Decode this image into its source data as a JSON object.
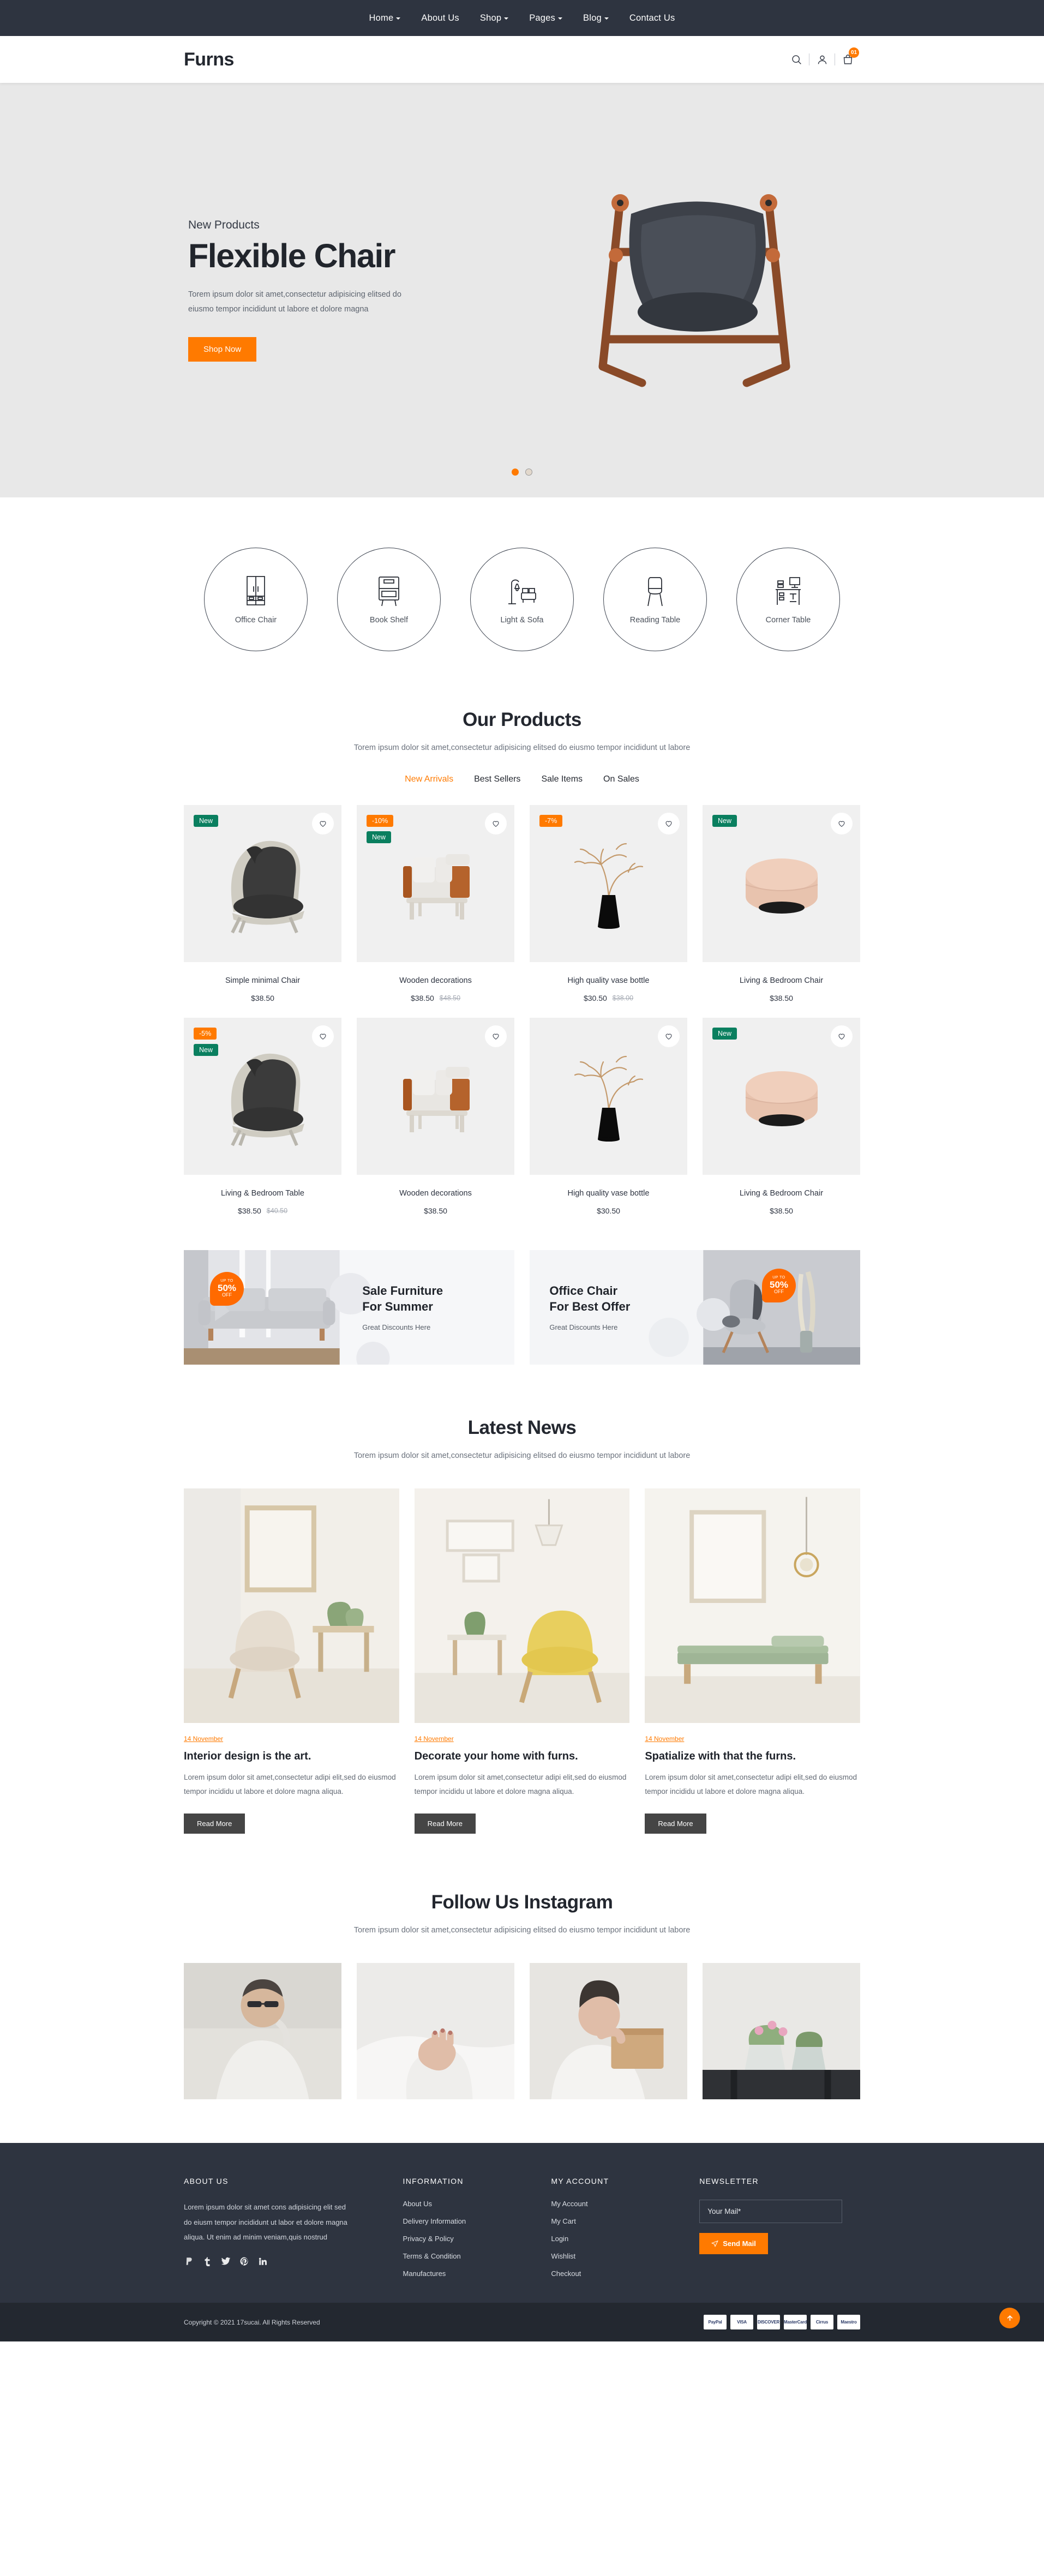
{
  "topnav": {
    "items": [
      {
        "label": "Home",
        "has_caret": true
      },
      {
        "label": "About Us",
        "has_caret": false
      },
      {
        "label": "Shop",
        "has_caret": true
      },
      {
        "label": "Pages",
        "has_caret": true
      },
      {
        "label": "Blog",
        "has_caret": true
      },
      {
        "label": "Contact Us",
        "has_caret": false
      }
    ]
  },
  "header": {
    "logo": "Furns",
    "search_icon": "search-icon",
    "account_icon": "user-icon",
    "cart_icon": "shopping-bag-icon",
    "cart_count": "01"
  },
  "hero": {
    "kicker": "New Products",
    "title": "Flexible Chair",
    "desc": "Torem ipsum dolor sit amet,consectetur adipisicing elitsed do eiusmo tempor incididunt ut labore et dolore magna",
    "cta": "Shop Now",
    "slides": 2,
    "active_slide": 0
  },
  "categories": [
    {
      "label": "Office Chair",
      "icon": "wardrobe-icon"
    },
    {
      "label": "Book Shelf",
      "icon": "cabinet-icon"
    },
    {
      "label": "Light & Sofa",
      "icon": "floor-lamp-sofa-icon"
    },
    {
      "label": "Reading Table",
      "icon": "stool-icon"
    },
    {
      "label": "Corner Table",
      "icon": "desk-icon"
    }
  ],
  "products_section": {
    "title": "Our Products",
    "subtitle": "Torem ipsum dolor sit amet,consectetur adipisicing elitsed do eiusmo tempor incididunt ut labore",
    "tabs": [
      {
        "label": "New Arrivals",
        "active": true
      },
      {
        "label": "Best Sellers",
        "active": false
      },
      {
        "label": "Sale Items",
        "active": false
      },
      {
        "label": "On Sales",
        "active": false
      }
    ],
    "items": [
      {
        "name": "Simple minimal Chair",
        "price": "$38.50",
        "old_price": "",
        "badges": [
          {
            "text": "New",
            "type": "new"
          }
        ],
        "image": "dark-lounge-chair"
      },
      {
        "name": "Wooden decorations",
        "price": "$38.50",
        "old_price": "$48.50",
        "badges": [
          {
            "text": "-10%",
            "type": "off"
          },
          {
            "text": "New",
            "type": "new"
          }
        ],
        "image": "white-armchair"
      },
      {
        "name": "High quality vase bottle",
        "price": "$30.50",
        "old_price": "$38.00",
        "badges": [
          {
            "text": "-7%",
            "type": "off"
          }
        ],
        "image": "black-vase-branches"
      },
      {
        "name": "Living & Bedroom Chair",
        "price": "$38.50",
        "old_price": "",
        "badges": [
          {
            "text": "New",
            "type": "new"
          }
        ],
        "image": "pink-round-ottoman"
      },
      {
        "name": "Living & Bedroom Table",
        "price": "$38.50",
        "old_price": "$40.50",
        "badges": [
          {
            "text": "-5%",
            "type": "off"
          },
          {
            "text": "New",
            "type": "new"
          }
        ],
        "image": "dark-lounge-chair"
      },
      {
        "name": "Wooden decorations",
        "price": "$38.50",
        "old_price": "",
        "badges": [],
        "image": "white-armchair"
      },
      {
        "name": "High quality vase bottle",
        "price": "$30.50",
        "old_price": "",
        "badges": [],
        "image": "black-vase-branches"
      },
      {
        "name": "Living & Bedroom Chair",
        "price": "$38.50",
        "old_price": "",
        "badges": [
          {
            "text": "New",
            "type": "new"
          }
        ],
        "image": "pink-round-ottoman"
      }
    ]
  },
  "banners": [
    {
      "title_line1": "Sale Furniture",
      "title_line2": "For Summer",
      "sub": "Great Discounts Here",
      "off_top": "UP TO",
      "off_num": "50%",
      "off_bottom": "OFF"
    },
    {
      "title_line1": "Office Chair",
      "title_line2": "For Best Offer",
      "sub": "Great Discounts Here",
      "off_top": "UP TO",
      "off_num": "50%",
      "off_bottom": "OFF"
    }
  ],
  "news_section": {
    "title": "Latest News",
    "subtitle": "Torem ipsum dolor sit amet,consectetur adipisicing elitsed do eiusmo tempor incididunt ut labore",
    "posts": [
      {
        "date": "14 November",
        "title": "Interior design is the art.",
        "text": "Lorem ipsum dolor sit amet,consectetur adipi elit,sed do eiusmod tempor incididu ut labore et dolore magna aliqua.",
        "button": "Read More",
        "image": "beige-armchair-room"
      },
      {
        "date": "14 November",
        "title": "Decorate your home with furns.",
        "text": "Lorem ipsum dolor sit amet,consectetur adipi elit,sed do eiusmod tempor incididu ut labore et dolore magna aliqua.",
        "button": "Read More",
        "image": "yellow-armchair-room"
      },
      {
        "date": "14 November",
        "title": "Spatialize with that the furns.",
        "text": "Lorem ipsum dolor sit amet,consectetur adipi elit,sed do eiusmod tempor incididu ut labore et dolore magna aliqua.",
        "button": "Read More",
        "image": "green-bench-room"
      }
    ]
  },
  "insta_section": {
    "title": "Follow Us Instagram",
    "subtitle": "Torem ipsum dolor sit amet,consectetur adipisicing elitsed do eiusmo tempor incididunt ut labore",
    "cells": [
      {
        "alt": "man-with-sunglasses"
      },
      {
        "alt": "woman-hands-nails"
      },
      {
        "alt": "woman-holding-box"
      },
      {
        "alt": "potted-plants-on-stool"
      }
    ]
  },
  "footer": {
    "about": {
      "heading": "ABOUT US",
      "text": "Lorem ipsum dolor sit amet cons adipisicing elit sed do eiusm tempor incididunt ut labor et dolore magna aliqua. Ut enim ad minim veniam,quis nostrud",
      "social": [
        {
          "name": "paypal-icon",
          "glyph": "P"
        },
        {
          "name": "tumblr-icon",
          "glyph": "t"
        },
        {
          "name": "twitter-icon",
          "glyph": "🐦"
        },
        {
          "name": "pinterest-icon",
          "glyph": "P"
        },
        {
          "name": "linkedin-icon",
          "glyph": "in"
        }
      ]
    },
    "information": {
      "heading": "INFORMATION",
      "links": [
        "About Us",
        "Delivery Information",
        "Privacy & Policy",
        "Terms & Condition",
        "Manufactures"
      ]
    },
    "my_account": {
      "heading": "MY ACCOUNT",
      "links": [
        "My Account",
        "My Cart",
        "Login",
        "Wishlist",
        "Checkout"
      ]
    },
    "newsletter": {
      "heading": "NEWSLETTER",
      "placeholder": "Your Mail*",
      "value": "",
      "button": "Send Mail",
      "button_icon": "send-icon"
    },
    "copyright": "Copyright © 2021 17sucai. All Rights Reserved",
    "payments": [
      "PayPal",
      "VISA",
      "DISCOVER",
      "MasterCard",
      "Cirrus",
      "Maestro"
    ],
    "to_top_icon": "arrow-up-icon"
  },
  "colors": {
    "accent": "#ff7a00",
    "dark": "#2e3440",
    "new_badge": "#0a7f5f",
    "hero_bg": "#e8e8e8",
    "card_bg": "#f0f0f0"
  }
}
